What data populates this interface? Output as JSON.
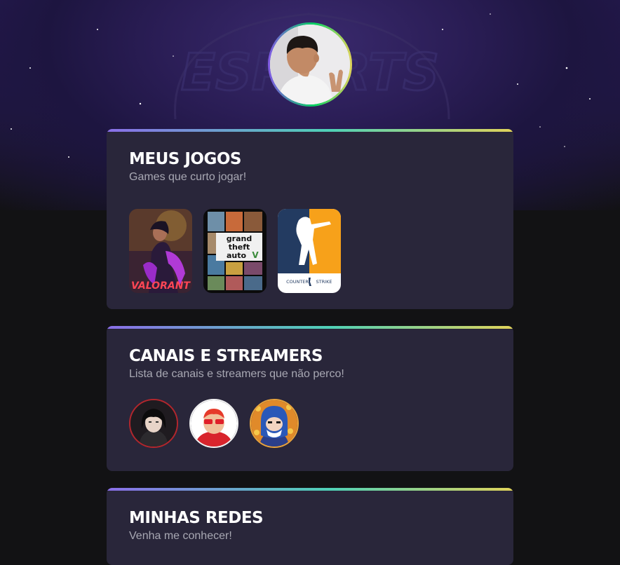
{
  "profile": {
    "avatar_icon": "profile-photo-peace-sign"
  },
  "background": {
    "watermark_text": "ESPORTS"
  },
  "sections": {
    "games": {
      "title": "MEUS JOGOS",
      "subtitle": "Games que curto jogar!",
      "items": [
        {
          "name": "VALORANT",
          "logo_text": "VALORANT"
        },
        {
          "name": "Grand Theft Auto V",
          "logo_lines": [
            "grand",
            "theft",
            "auto"
          ]
        },
        {
          "name": "Counter-Strike",
          "logo_text": "COUNTER",
          "logo_text_2": "STRIKE"
        }
      ]
    },
    "streamers": {
      "title": "CANAIS E STREAMERS",
      "subtitle": "Lista de canais e streamers que não perco!",
      "items": [
        {
          "icon": "streamer-avatar-dark-hair"
        },
        {
          "icon": "streamer-avatar-red-glasses"
        },
        {
          "icon": "streamer-avatar-blue-mask"
        }
      ]
    },
    "socials": {
      "title": "MINHAS REDES",
      "subtitle": "Venha me conhecer!"
    }
  },
  "colors": {
    "page_bg": "#121214",
    "card_bg": "#29263a",
    "gradient": [
      "#8a6ee8",
      "#4fd1b6",
      "#e1d35a"
    ],
    "subtitle": "#a8a8b3"
  }
}
